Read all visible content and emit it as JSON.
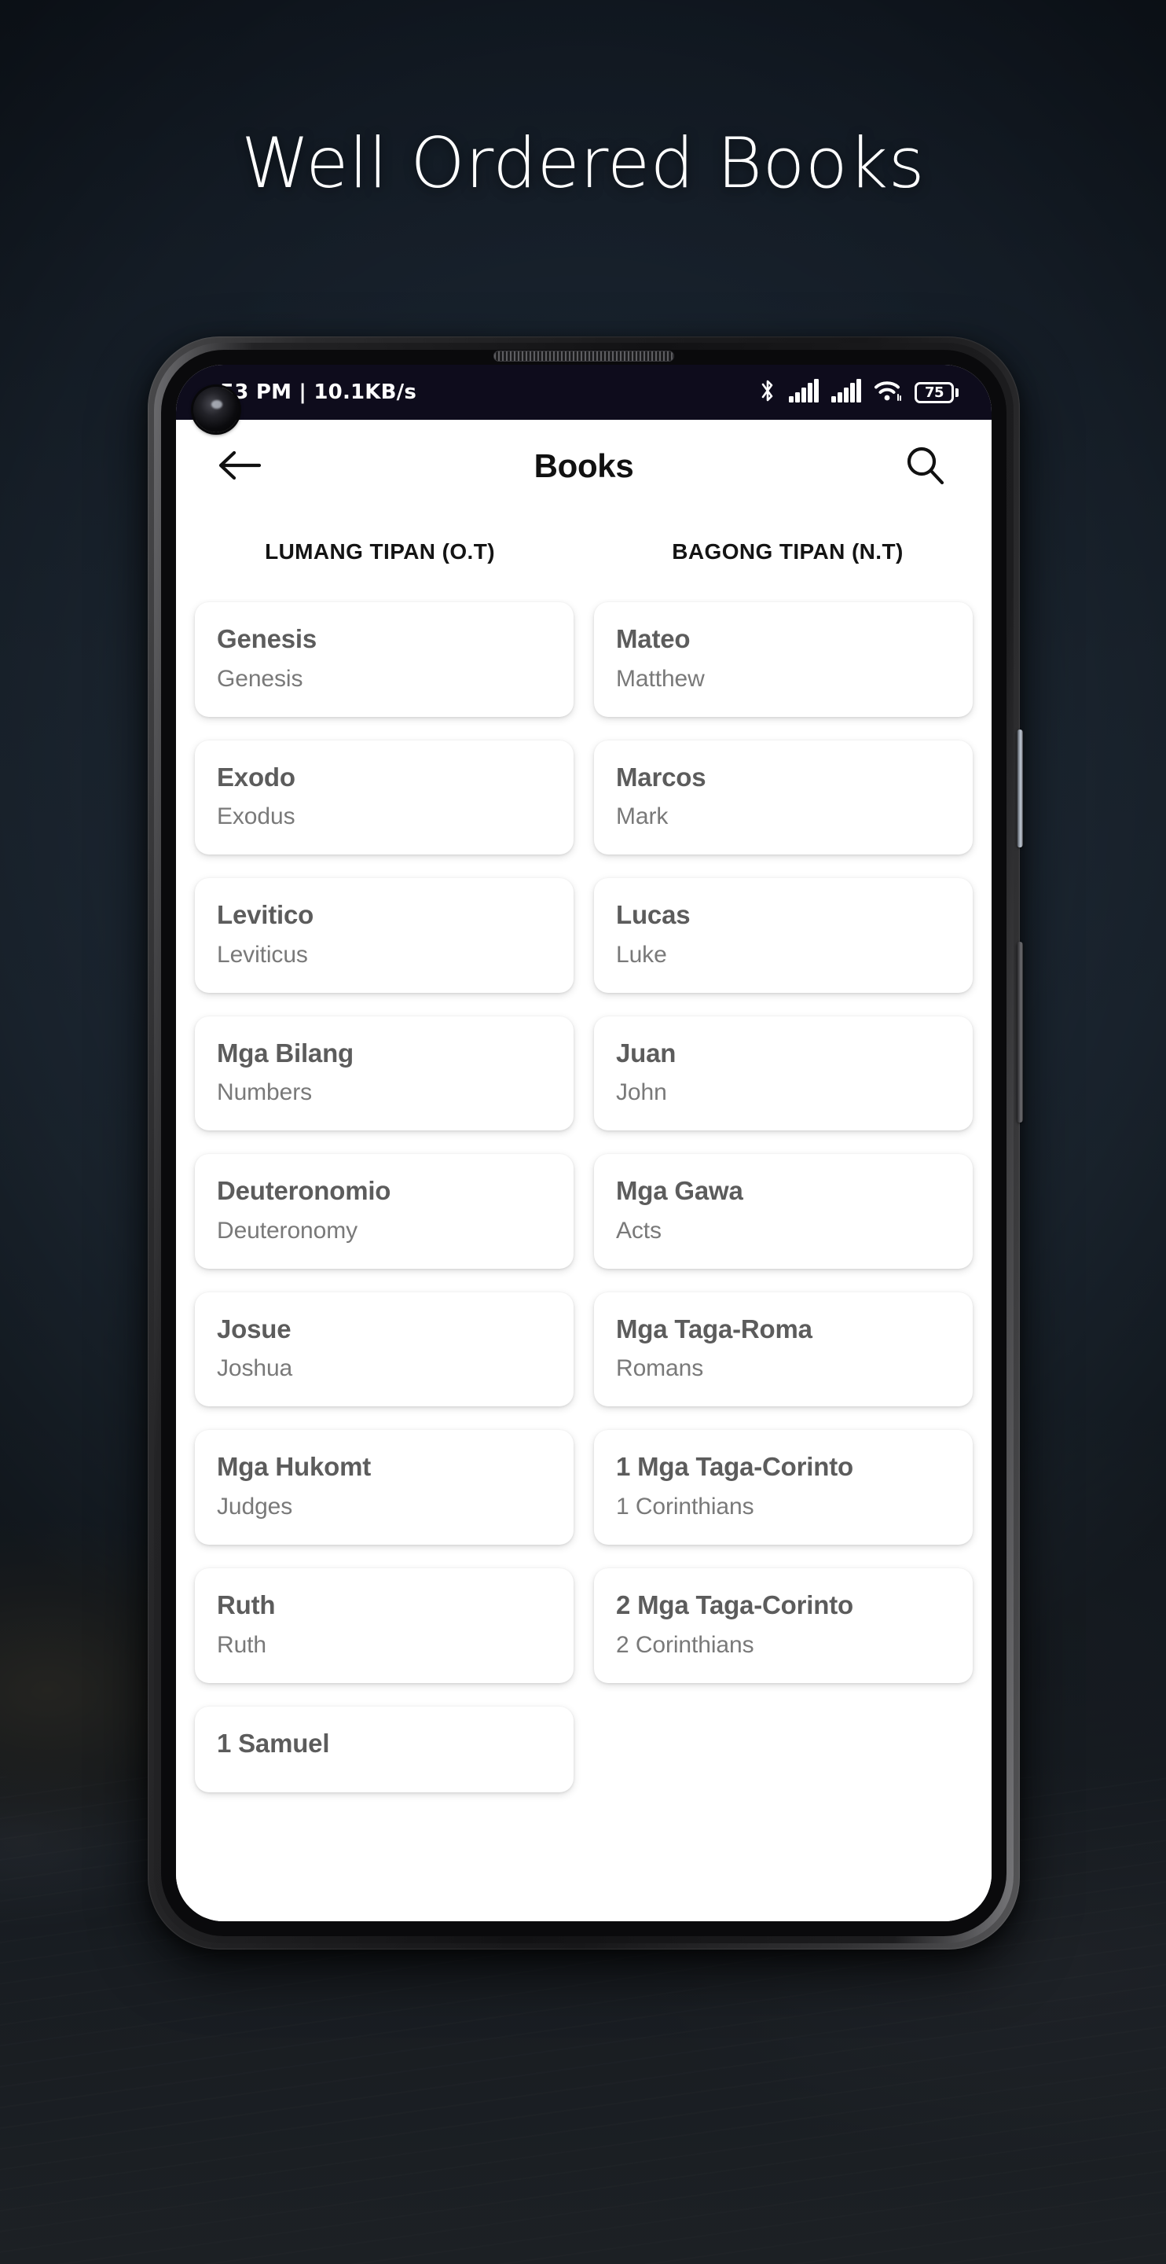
{
  "promo": {
    "headline": "Well Ordered Books"
  },
  "phone": {
    "status_bar": {
      "left_text": "53 PM | 10.1KB/s",
      "bluetooth_icon": "bluetooth-icon",
      "signal1_icon": "signal-bars-icon",
      "signal2_icon": "signal-bars-icon",
      "wifi_icon": "wifi-icon",
      "battery_level": "75"
    },
    "app_bar": {
      "back_icon": "back-arrow-icon",
      "title": "Books",
      "search_icon": "search-icon"
    },
    "tabs": [
      {
        "label": "LUMANG TIPAN (O.T)"
      },
      {
        "label": "BAGONG TIPAN (N.T)"
      }
    ],
    "old_testament": [
      {
        "title": "Genesis",
        "subtitle": "Genesis"
      },
      {
        "title": "Exodo",
        "subtitle": "Exodus"
      },
      {
        "title": "Levitico",
        "subtitle": "Leviticus"
      },
      {
        "title": "Mga Bilang",
        "subtitle": "Numbers"
      },
      {
        "title": "Deuteronomio",
        "subtitle": "Deuteronomy"
      },
      {
        "title": "Josue",
        "subtitle": "Joshua"
      },
      {
        "title": "Mga Hukomt",
        "subtitle": "Judges"
      },
      {
        "title": "Ruth",
        "subtitle": "Ruth"
      },
      {
        "title": "1 Samuel",
        "subtitle": ""
      }
    ],
    "new_testament": [
      {
        "title": "Mateo",
        "subtitle": "Matthew"
      },
      {
        "title": "Marcos",
        "subtitle": "Mark"
      },
      {
        "title": "Lucas",
        "subtitle": "Luke"
      },
      {
        "title": "Juan",
        "subtitle": "John"
      },
      {
        "title": "Mga Gawa",
        "subtitle": "Acts"
      },
      {
        "title": "Mga Taga-Roma",
        "subtitle": "Romans"
      },
      {
        "title": "1 Mga Taga-Corinto",
        "subtitle": "1 Corinthians"
      },
      {
        "title": "2 Mga Taga-Corinto",
        "subtitle": "2 Corinthians"
      }
    ]
  },
  "colors": {
    "background_navy": "#233242",
    "status_bar": "#0e0c1c",
    "card_title": "#5c5c5c",
    "card_subtitle": "#797979",
    "app_bar_title": "#111111"
  }
}
